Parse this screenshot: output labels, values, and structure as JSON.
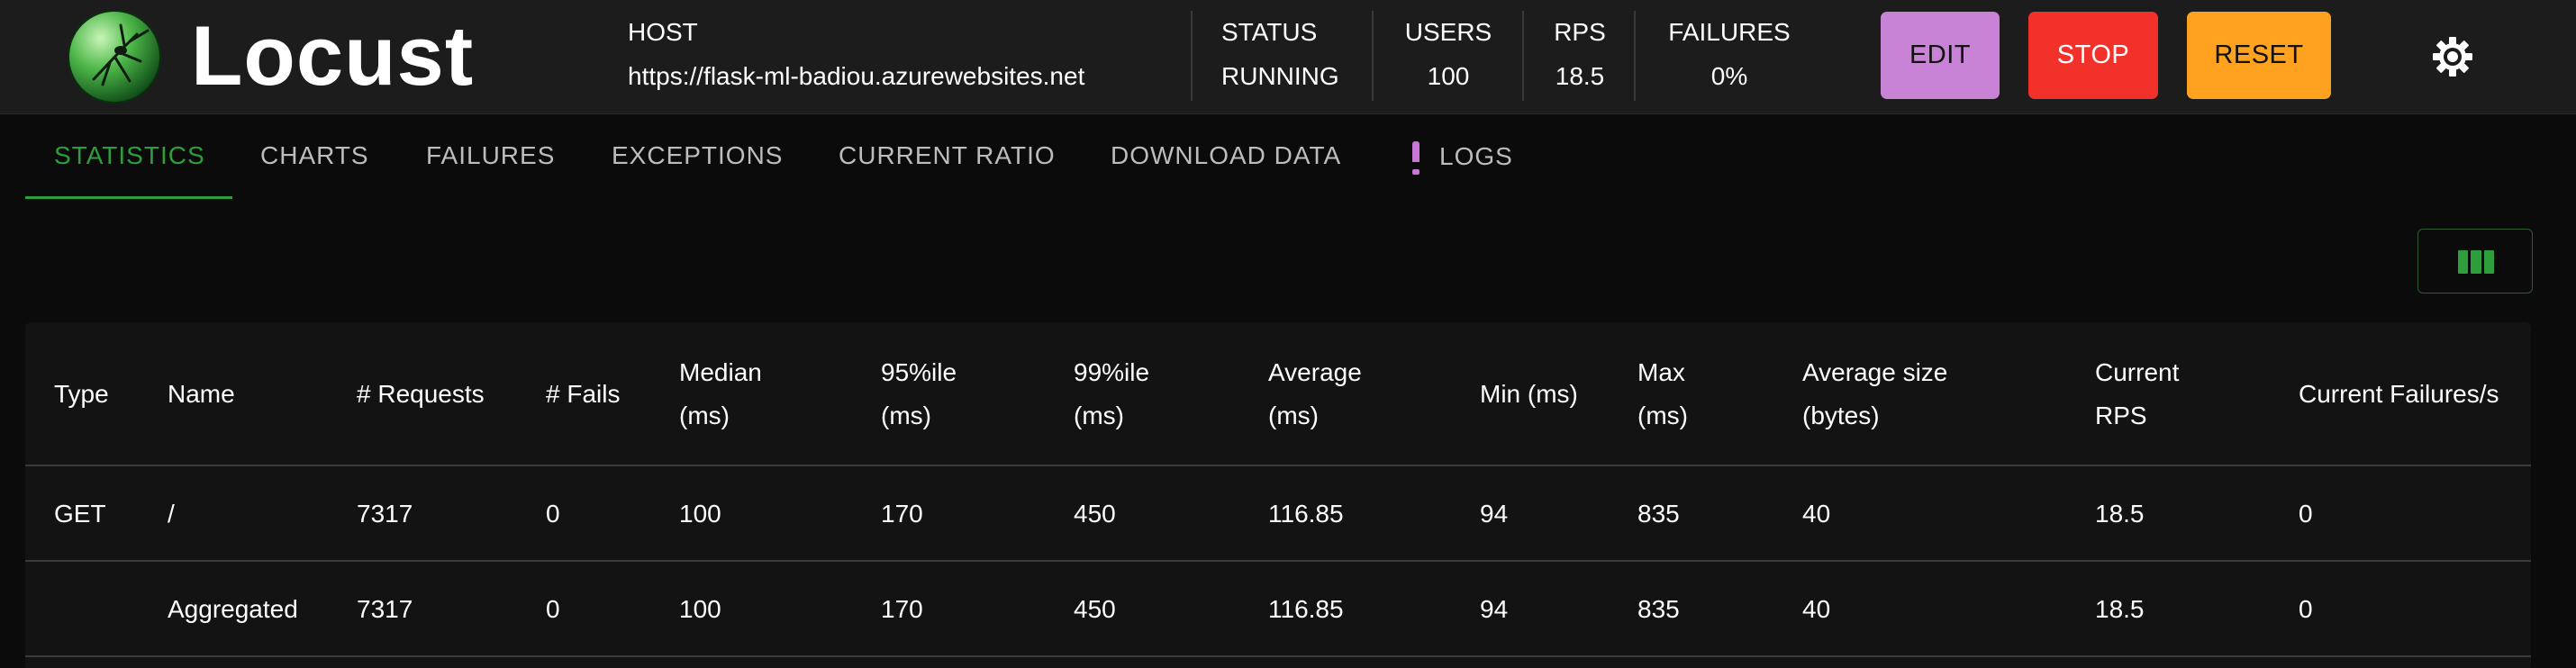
{
  "brand": {
    "name": "Locust",
    "logo_icon": "locust-logo-icon"
  },
  "stats": {
    "host": {
      "label": "HOST",
      "value": "https://flask-ml-badiou.azurewebsites.net"
    },
    "status": {
      "label": "STATUS",
      "value": "RUNNING"
    },
    "users": {
      "label": "USERS",
      "value": "100"
    },
    "rps": {
      "label": "RPS",
      "value": "18.5"
    },
    "failures": {
      "label": "FAILURES",
      "value": "0%"
    }
  },
  "buttons": {
    "edit": {
      "label": "EDIT",
      "color": "#c882d6"
    },
    "stop": {
      "label": "STOP",
      "color": "#f2322a"
    },
    "reset": {
      "label": "RESET",
      "color": "#ffa21f"
    },
    "theme_icon": "gear-icon"
  },
  "tabs": [
    {
      "label": "STATISTICS",
      "active": true
    },
    {
      "label": "CHARTS"
    },
    {
      "label": "FAILURES"
    },
    {
      "label": "EXCEPTIONS"
    },
    {
      "label": "CURRENT RATIO"
    },
    {
      "label": "DOWNLOAD DATA"
    },
    {
      "label": "LOGS",
      "icon": "exclamation-icon"
    }
  ],
  "accent_color": "#2e9d3c",
  "column_toggle_icon": "view-columns-icon",
  "table": {
    "headers": [
      [
        "Type"
      ],
      [
        "Name"
      ],
      [
        "# Requests"
      ],
      [
        "# Fails"
      ],
      [
        "Median",
        "(ms)"
      ],
      [
        "95%ile",
        "(ms)"
      ],
      [
        "99%ile",
        "(ms)"
      ],
      [
        "Average",
        "(ms)"
      ],
      [
        "Min (ms)"
      ],
      [
        "Max",
        "(ms)"
      ],
      [
        "Average size",
        "(bytes)"
      ],
      [
        "Current",
        "RPS"
      ],
      [
        "Current Failures/s"
      ]
    ],
    "rows": [
      [
        "GET",
        "/",
        "7317",
        "0",
        "100",
        "170",
        "450",
        "116.85",
        "94",
        "835",
        "40",
        "18.5",
        "0"
      ],
      [
        "",
        "Aggregated",
        "7317",
        "0",
        "100",
        "170",
        "450",
        "116.85",
        "94",
        "835",
        "40",
        "18.5",
        "0"
      ]
    ]
  }
}
